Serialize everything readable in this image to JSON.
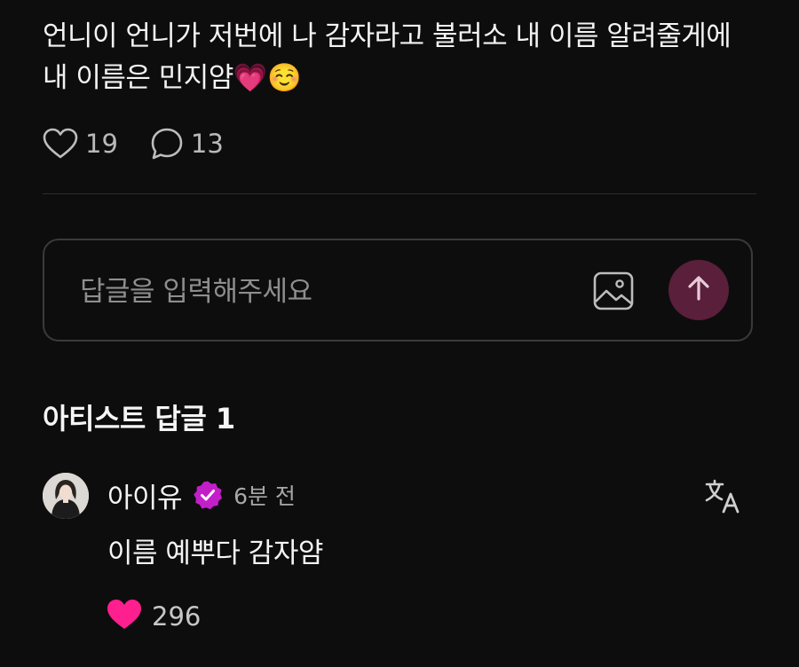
{
  "post": {
    "text": "언니이 언니가 저번에 나 감자라고 불러소 내 이름 알려줄게에 내 이름은 민지얌💗☺️",
    "like_count": "19",
    "comment_count": "13"
  },
  "reply_box": {
    "placeholder": "답글을 입력해주세요"
  },
  "artist_replies": {
    "title": "아티스트 답글 1"
  },
  "comment": {
    "author": "아이유",
    "time": "6분 전",
    "text": "이름 예뿌다 감자얌",
    "like_count": "296"
  },
  "icons": {
    "like": "heart-outline-icon",
    "comment": "speech-bubble-icon",
    "image": "image-icon",
    "send": "arrow-up-icon",
    "verified": "verified-badge-icon",
    "translate": "translate-icon",
    "liked": "heart-filled-icon"
  },
  "colors": {
    "background": "#0d0d0d",
    "send_button": "#5a1f3a",
    "verified_badge": "#c21fc9",
    "liked_heart": "#ff1f8e"
  }
}
